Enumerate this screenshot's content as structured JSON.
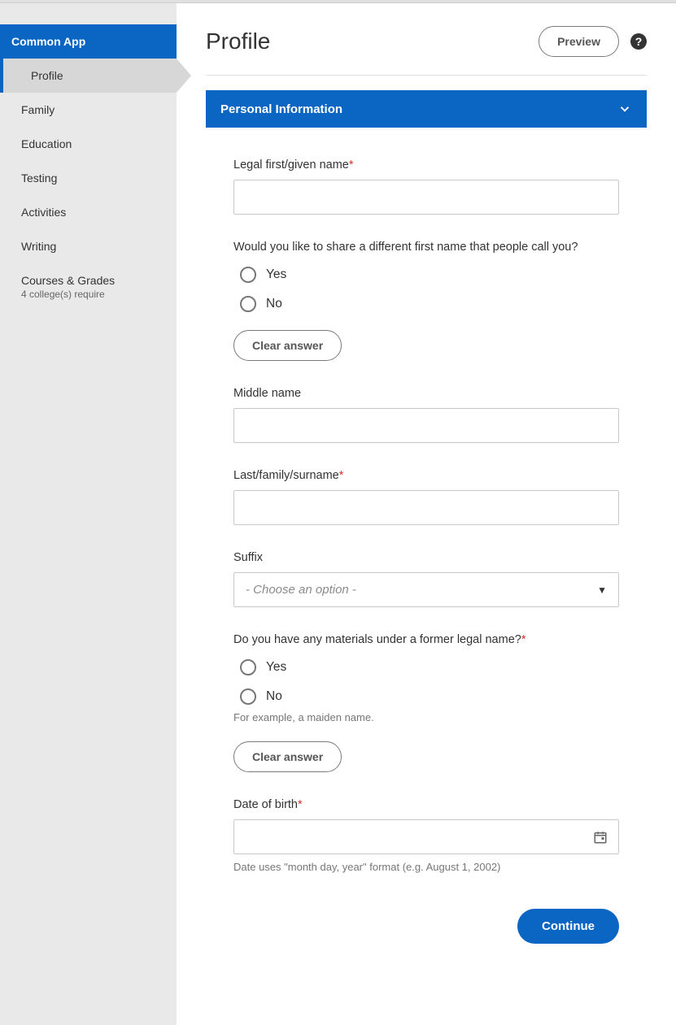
{
  "app_title": "Common App",
  "sidebar": {
    "items": [
      {
        "label": "Profile",
        "active": true
      },
      {
        "label": "Family"
      },
      {
        "label": "Education"
      },
      {
        "label": "Testing"
      },
      {
        "label": "Activities"
      },
      {
        "label": "Writing"
      },
      {
        "label": "Courses & Grades",
        "sub": "4 college(s) require"
      }
    ]
  },
  "page": {
    "title": "Profile",
    "preview_label": "Preview",
    "help_glyph": "?"
  },
  "section": {
    "title": "Personal Information"
  },
  "form": {
    "first_name": {
      "label": "Legal first/given name",
      "value": ""
    },
    "diff_first": {
      "question": "Would you like to share a different first name that people call you?",
      "yes": "Yes",
      "no": "No",
      "clear": "Clear answer"
    },
    "middle_name": {
      "label": "Middle name",
      "value": ""
    },
    "last_name": {
      "label": "Last/family/surname",
      "value": ""
    },
    "suffix": {
      "label": "Suffix",
      "placeholder": "- Choose an option -"
    },
    "former_name": {
      "question": "Do you have any materials under a former legal name?",
      "yes": "Yes",
      "no": "No",
      "helper": "For example, a maiden name.",
      "clear": "Clear answer"
    },
    "dob": {
      "label": "Date of birth",
      "value": "",
      "helper": "Date uses \"month day, year\" format (e.g. August 1, 2002)"
    }
  },
  "continue_label": "Continue"
}
